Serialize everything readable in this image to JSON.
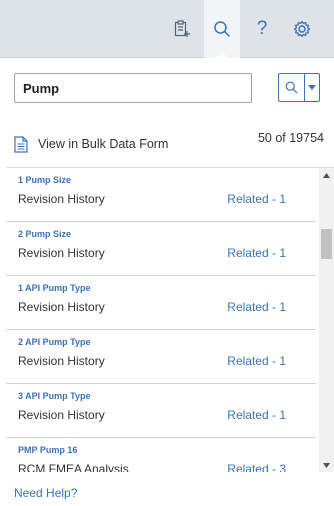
{
  "toolbar": {
    "icons": [
      "add-to-list-icon",
      "search-icon",
      "help-icon",
      "settings-icon"
    ],
    "help_glyph": "?",
    "accent": "#3b73b9"
  },
  "search": {
    "value": "Pump",
    "button_icon": "search-icon",
    "dropdown_icon": "caret-down-icon"
  },
  "bulk": {
    "label": "View in Bulk Data Form",
    "count": "50 of 19754"
  },
  "results": [
    {
      "title": "1 Pump Size",
      "subtitle": "Revision History",
      "related": "Related - 1"
    },
    {
      "title": "2 Pump Size",
      "subtitle": "Revision History",
      "related": "Related - 1"
    },
    {
      "title": "1 API Pump Type",
      "subtitle": "Revision History",
      "related": "Related - 1"
    },
    {
      "title": "2 API Pump Type",
      "subtitle": "Revision History",
      "related": "Related - 1"
    },
    {
      "title": "3 API Pump Type",
      "subtitle": "Revision History",
      "related": "Related - 1"
    },
    {
      "title": "PMP Pump 16",
      "subtitle": "RCM FMEA Analysis",
      "related": "Related - 3"
    }
  ],
  "footer": {
    "help_label": "Need Help?"
  }
}
